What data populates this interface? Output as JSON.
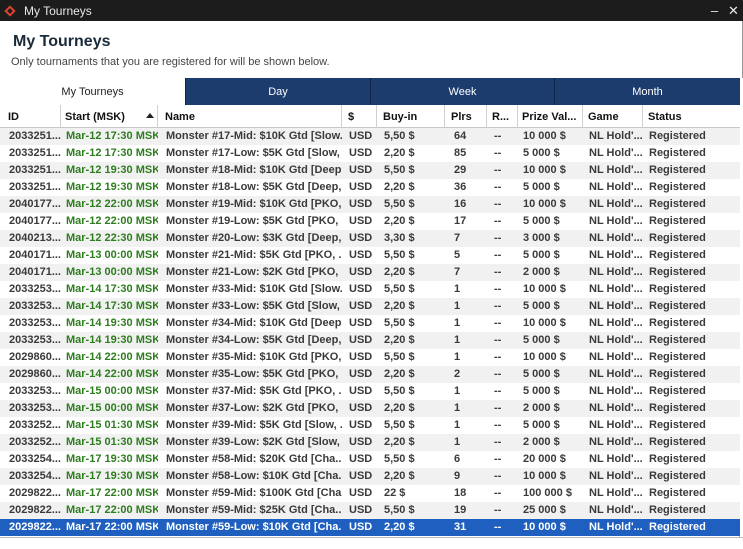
{
  "window": {
    "title": "My Tourneys",
    "minimize_label": "–",
    "close_label": "✕",
    "logo_icon": "app-logo-icon"
  },
  "header": {
    "title": "My Tourneys",
    "subtitle": "Only tournaments that you are registered for will be shown below."
  },
  "tabs": [
    {
      "label": "My Tourneys",
      "active": true
    },
    {
      "label": "Day",
      "active": false
    },
    {
      "label": "Week",
      "active": false
    },
    {
      "label": "Month",
      "active": false
    }
  ],
  "columns": {
    "id": "ID",
    "start": "Start (MSK)",
    "name": "Name",
    "currency": "$",
    "buyin": "Buy-in",
    "plrs": "Plrs",
    "re": "R...",
    "prize": "Prize Val...",
    "game": "Game",
    "status": "Status"
  },
  "colors": {
    "tab_bar": "#1c3c6e",
    "start_text": "#2e7d1f",
    "selected_row": "#1f5fbf"
  },
  "rows": [
    {
      "id": "2033251...",
      "start": "Mar-12 17:30 MSK",
      "name": "Monster #17-Mid: $10K Gtd [Slow...",
      "cur": "USD",
      "buyin": "5,50 $",
      "plrs": "64",
      "re": "--",
      "prize": "10 000 $",
      "game": "NL Hold'...",
      "status": "Registered"
    },
    {
      "id": "2033251...",
      "start": "Mar-12 17:30 MSK",
      "name": "Monster #17-Low: $5K Gtd [Slow, ...",
      "cur": "USD",
      "buyin": "2,20 $",
      "plrs": "85",
      "re": "--",
      "prize": "5 000 $",
      "game": "NL Hold'...",
      "status": "Registered"
    },
    {
      "id": "2033251...",
      "start": "Mar-12 19:30 MSK",
      "name": "Monster #18-Mid: $10K Gtd [Deep...",
      "cur": "USD",
      "buyin": "5,50 $",
      "plrs": "29",
      "re": "--",
      "prize": "10 000 $",
      "game": "NL Hold'...",
      "status": "Registered"
    },
    {
      "id": "2033251...",
      "start": "Mar-12 19:30 MSK",
      "name": "Monster #18-Low: $5K Gtd [Deep,...",
      "cur": "USD",
      "buyin": "2,20 $",
      "plrs": "36",
      "re": "--",
      "prize": "5 000 $",
      "game": "NL Hold'...",
      "status": "Registered"
    },
    {
      "id": "2040177...",
      "start": "Mar-12 22:00 MSK",
      "name": "Monster #19-Mid: $10K Gtd [PKO,...",
      "cur": "USD",
      "buyin": "5,50 $",
      "plrs": "16",
      "re": "--",
      "prize": "10 000 $",
      "game": "NL Hold'...",
      "status": "Registered"
    },
    {
      "id": "2040177...",
      "start": "Mar-12 22:00 MSK",
      "name": "Monster #19-Low: $5K Gtd [PKO, ...",
      "cur": "USD",
      "buyin": "2,20 $",
      "plrs": "17",
      "re": "--",
      "prize": "5 000 $",
      "game": "NL Hold'...",
      "status": "Registered"
    },
    {
      "id": "2040213...",
      "start": "Mar-12 22:30 MSK",
      "name": "Monster #20-Low: $3K Gtd [Deep,...",
      "cur": "USD",
      "buyin": "3,30 $",
      "plrs": "7",
      "re": "--",
      "prize": "3 000 $",
      "game": "NL Hold'...",
      "status": "Registered"
    },
    {
      "id": "2040171...",
      "start": "Mar-13 00:00 MSK",
      "name": "Monster #21-Mid: $5K Gtd [PKO, ...",
      "cur": "USD",
      "buyin": "5,50 $",
      "plrs": "5",
      "re": "--",
      "prize": "5 000 $",
      "game": "NL Hold'...",
      "status": "Registered"
    },
    {
      "id": "2040171...",
      "start": "Mar-13 00:00 MSK",
      "name": "Monster #21-Low: $2K Gtd [PKO, ...",
      "cur": "USD",
      "buyin": "2,20 $",
      "plrs": "7",
      "re": "--",
      "prize": "2 000 $",
      "game": "NL Hold'...",
      "status": "Registered"
    },
    {
      "id": "2033253...",
      "start": "Mar-14 17:30 MSK",
      "name": "Monster #33-Mid: $10K Gtd [Slow...",
      "cur": "USD",
      "buyin": "5,50 $",
      "plrs": "1",
      "re": "--",
      "prize": "10 000 $",
      "game": "NL Hold'...",
      "status": "Registered"
    },
    {
      "id": "2033253...",
      "start": "Mar-14 17:30 MSK",
      "name": "Monster #33-Low: $5K Gtd [Slow, ...",
      "cur": "USD",
      "buyin": "2,20 $",
      "plrs": "1",
      "re": "--",
      "prize": "5 000 $",
      "game": "NL Hold'...",
      "status": "Registered"
    },
    {
      "id": "2033253...",
      "start": "Mar-14 19:30 MSK",
      "name": "Monster #34-Mid: $10K Gtd [Deep...",
      "cur": "USD",
      "buyin": "5,50 $",
      "plrs": "1",
      "re": "--",
      "prize": "10 000 $",
      "game": "NL Hold'...",
      "status": "Registered"
    },
    {
      "id": "2033253...",
      "start": "Mar-14 19:30 MSK",
      "name": "Monster #34-Low: $5K Gtd [Deep,...",
      "cur": "USD",
      "buyin": "2,20 $",
      "plrs": "1",
      "re": "--",
      "prize": "5 000 $",
      "game": "NL Hold'...",
      "status": "Registered"
    },
    {
      "id": "2029860...",
      "start": "Mar-14 22:00 MSK",
      "name": "Monster #35-Mid: $10K Gtd [PKO,...",
      "cur": "USD",
      "buyin": "5,50 $",
      "plrs": "1",
      "re": "--",
      "prize": "10 000 $",
      "game": "NL Hold'...",
      "status": "Registered"
    },
    {
      "id": "2029860...",
      "start": "Mar-14 22:00 MSK",
      "name": "Monster #35-Low: $5K Gtd [PKO, ...",
      "cur": "USD",
      "buyin": "2,20 $",
      "plrs": "2",
      "re": "--",
      "prize": "5 000 $",
      "game": "NL Hold'...",
      "status": "Registered"
    },
    {
      "id": "2033253...",
      "start": "Mar-15 00:00 MSK",
      "name": "Monster #37-Mid: $5K Gtd [PKO, ...",
      "cur": "USD",
      "buyin": "5,50 $",
      "plrs": "1",
      "re": "--",
      "prize": "5 000 $",
      "game": "NL Hold'...",
      "status": "Registered"
    },
    {
      "id": "2033253...",
      "start": "Mar-15 00:00 MSK",
      "name": "Monster #37-Low: $2K Gtd [PKO, ...",
      "cur": "USD",
      "buyin": "2,20 $",
      "plrs": "1",
      "re": "--",
      "prize": "2 000 $",
      "game": "NL Hold'...",
      "status": "Registered"
    },
    {
      "id": "2033252...",
      "start": "Mar-15 01:30 MSK",
      "name": "Monster #39-Mid: $5K Gtd [Slow, ...",
      "cur": "USD",
      "buyin": "5,50 $",
      "plrs": "1",
      "re": "--",
      "prize": "5 000 $",
      "game": "NL Hold'...",
      "status": "Registered"
    },
    {
      "id": "2033252...",
      "start": "Mar-15 01:30 MSK",
      "name": "Monster #39-Low: $2K Gtd [Slow, ...",
      "cur": "USD",
      "buyin": "2,20 $",
      "plrs": "1",
      "re": "--",
      "prize": "2 000 $",
      "game": "NL Hold'...",
      "status": "Registered"
    },
    {
      "id": "2033254...",
      "start": "Mar-17 19:30 MSK",
      "name": "Monster #58-Mid: $20K Gtd [Cha...",
      "cur": "USD",
      "buyin": "5,50 $",
      "plrs": "6",
      "re": "--",
      "prize": "20 000 $",
      "game": "NL Hold'...",
      "status": "Registered"
    },
    {
      "id": "2033254...",
      "start": "Mar-17 19:30 MSK",
      "name": "Monster #58-Low: $10K Gtd [Cha...",
      "cur": "USD",
      "buyin": "2,20 $",
      "plrs": "9",
      "re": "--",
      "prize": "10 000 $",
      "game": "NL Hold'...",
      "status": "Registered"
    },
    {
      "id": "2029822...",
      "start": "Mar-17 22:00 MSK",
      "name": "Monster #59-Mid: $100K Gtd [Cha...",
      "cur": "USD",
      "buyin": "22 $",
      "plrs": "18",
      "re": "--",
      "prize": "100 000 $",
      "game": "NL Hold'...",
      "status": "Registered"
    },
    {
      "id": "2029822...",
      "start": "Mar-17 22:00 MSK",
      "name": "Monster #59-Mid: $25K Gtd [Cha...",
      "cur": "USD",
      "buyin": "5,50 $",
      "plrs": "19",
      "re": "--",
      "prize": "25 000 $",
      "game": "NL Hold'...",
      "status": "Registered"
    },
    {
      "id": "2029822...",
      "start": "Mar-17 22:00 MSK",
      "name": "Monster #59-Low: $10K Gtd [Cha...",
      "cur": "USD",
      "buyin": "2,20 $",
      "plrs": "31",
      "re": "--",
      "prize": "10 000 $",
      "game": "NL Hold'...",
      "status": "Registered",
      "selected": true
    }
  ]
}
